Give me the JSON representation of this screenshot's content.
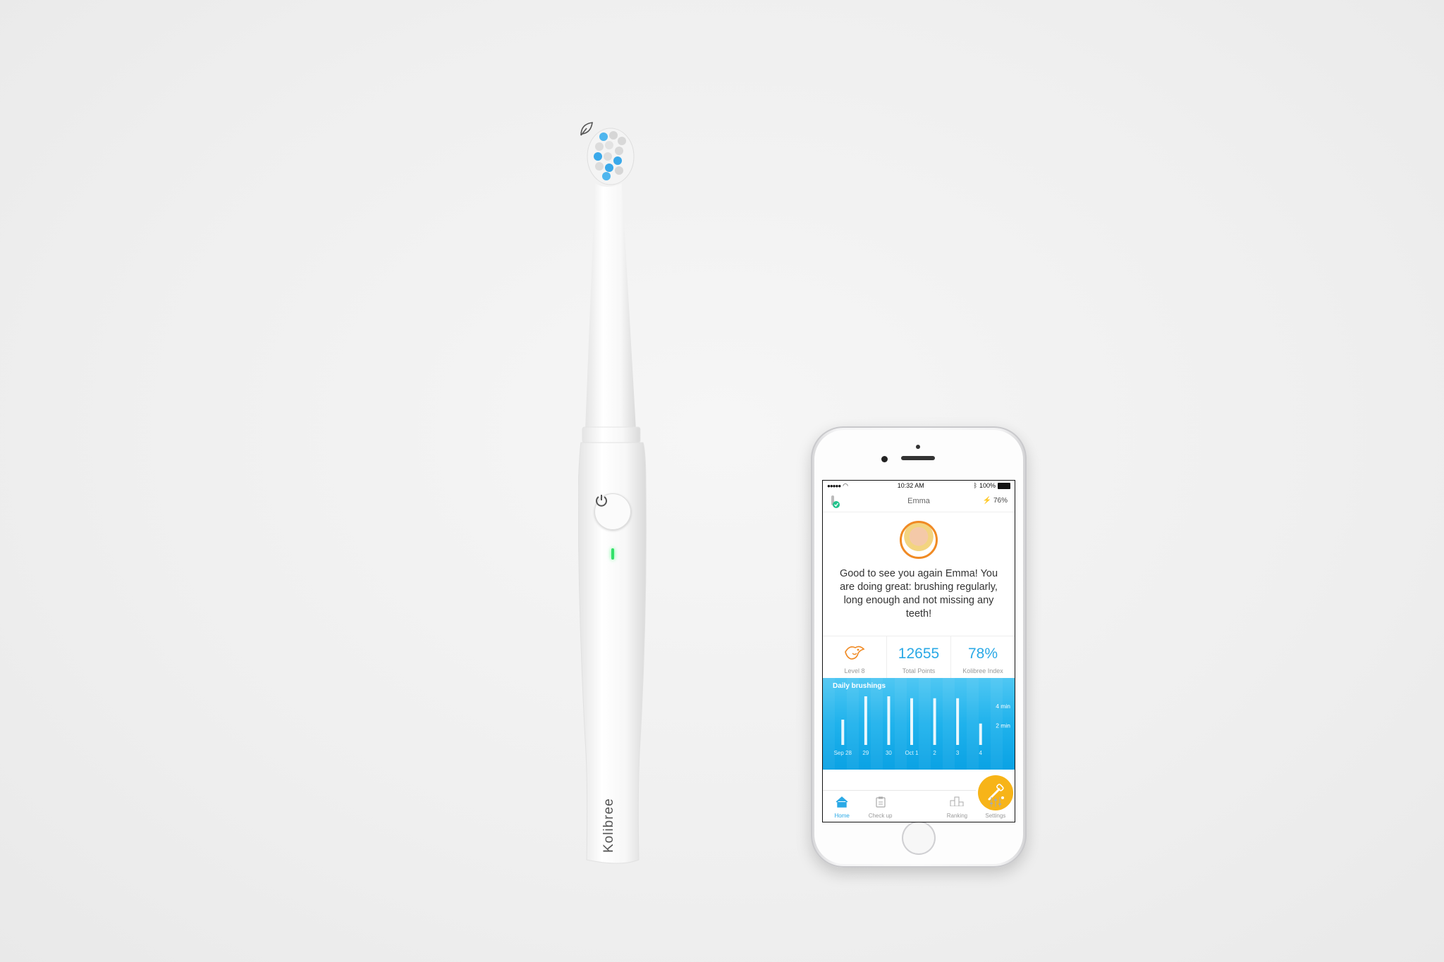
{
  "toothbrush": {
    "brand": "Kolibree",
    "led_color": "#33e06a",
    "bristle_accent": "#3aa9ea"
  },
  "phone": {
    "status_bar": {
      "time": "10:32 AM",
      "battery": "100%"
    },
    "header": {
      "title": "Emma",
      "brush_battery": "76%"
    },
    "message": "Good to see you again Emma! You are doing great: brushing regularly, long enough and not missing any teeth!",
    "stats": [
      {
        "value": "",
        "label": "Level 8"
      },
      {
        "value": "12655",
        "label": "Total Points"
      },
      {
        "value": "78%",
        "label": "Kolibree Index"
      }
    ],
    "chart_data": {
      "type": "bar",
      "title": "Daily brushings",
      "categories": [
        "Sep 28",
        "29",
        "30",
        "Oct 1",
        "2",
        "3",
        "4"
      ],
      "y_ticks": [
        "4 min",
        "2 min"
      ],
      "ylim": [
        0,
        5
      ],
      "series": [
        {
          "name": "",
          "values": [
            2.6,
            5.0,
            5.0,
            4.8,
            4.8,
            4.8,
            2.2
          ]
        }
      ]
    },
    "tabs": [
      {
        "label": "Home",
        "icon": "home-icon",
        "active": true
      },
      {
        "label": "Check up",
        "icon": "clipboard-icon",
        "active": false
      },
      {
        "label": "",
        "icon": "toothbrush-icon",
        "active": false
      },
      {
        "label": "Ranking",
        "icon": "podium-icon",
        "active": false
      },
      {
        "label": "Settings",
        "icon": "sliders-icon",
        "active": false
      }
    ],
    "accent_color": "#2aa9e6",
    "brush_button_color": "#f7b418"
  }
}
